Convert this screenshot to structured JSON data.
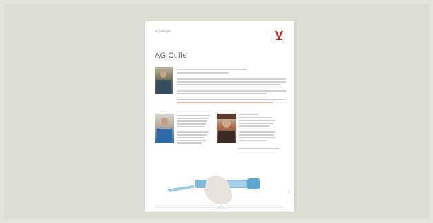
{
  "page": {
    "header": "Vol. 2 | Fall 2016",
    "title": "AG Cuffe",
    "colors": {
      "background": "#e3e4db",
      "panel": "#dcded3",
      "accent": "#c62a24"
    }
  }
}
